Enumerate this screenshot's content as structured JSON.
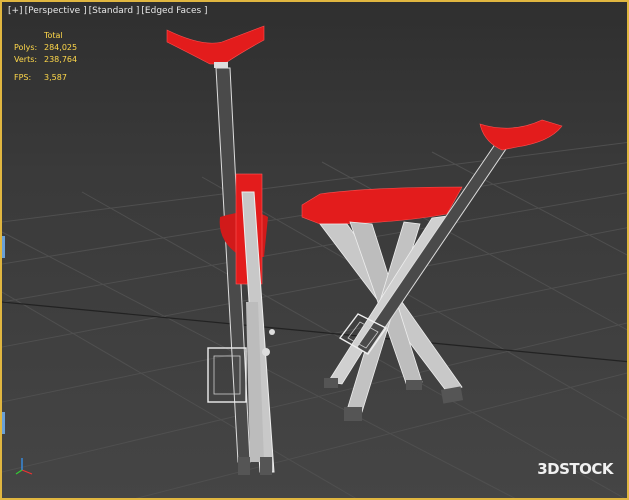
{
  "viewport": {
    "label_parts": [
      "[+]",
      "[Perspective ]",
      "[Standard ]",
      "[Edged Faces ]"
    ]
  },
  "stats": {
    "total_label": "Total",
    "polys_label": "Polys:",
    "polys_value": "284,025",
    "verts_label": "Verts:",
    "verts_value": "238,764",
    "fps_label": "FPS:",
    "fps_value": "3,587"
  },
  "watermark": {
    "text": "3DSTOCK"
  },
  "colors": {
    "frame": "#e0b640",
    "stats_text": "#ffd84a",
    "seat_red": "#e31c1c",
    "grid_line": "#505050"
  },
  "objects": [
    "walking-cane-stool-folded",
    "walking-cane-stool-open"
  ]
}
